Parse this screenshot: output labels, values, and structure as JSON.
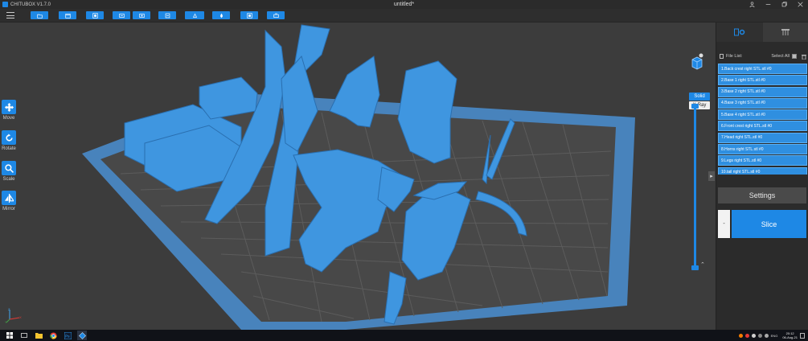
{
  "window": {
    "app_name": "CHITUBOX V1.7.0",
    "doc_title": "untitled*",
    "controls": [
      "user-icon",
      "minimize-icon",
      "maximize-icon",
      "close-icon"
    ]
  },
  "toolbar": {
    "buttons": [
      "open-file-icon",
      "open-folder-icon",
      "auto-layout-icon",
      "hollow-icon",
      "dig-hole-icon",
      "measure-icon",
      "support-icon",
      "resin-icon",
      "preview-icon",
      "print-icon"
    ]
  },
  "left_tools": [
    {
      "label": "Move",
      "icon": "move-icon"
    },
    {
      "label": "Rotate",
      "icon": "rotate-icon"
    },
    {
      "label": "Scale",
      "icon": "scale-icon"
    },
    {
      "label": "Mirror",
      "icon": "mirror-icon"
    }
  ],
  "view_modes": {
    "solid": "Solid",
    "xray": "X-Ray",
    "selected": "Solid"
  },
  "right_panel": {
    "tabs": [
      "file-settings-icon",
      "supports-icon"
    ],
    "file_list_label": "File List:",
    "select_all_label": "Select All",
    "files": [
      "1.Back crest right STL.stl #0",
      "2.Base 1 right STL.stl #0",
      "3.Base 2 right STL.stl #0",
      "4.Base 3 right STL.stl #0",
      "5.Base 4 right STL.stl #0",
      "6.Front crest right STL.stl #0",
      "7.Head right STL.stl #0",
      "8.Horns right STL.stl #0",
      "9.Legs right STL.stl #0",
      "10.tail right STL.stl #0"
    ],
    "settings_label": "Settings",
    "minus_label": "-",
    "slice_label": "Slice"
  },
  "taskbar": {
    "apps": [
      "start-icon",
      "taskview-icon",
      "file-explorer-icon",
      "chrome-icon",
      "photoshop-icon",
      "chitubox-icon"
    ],
    "language": "ENG",
    "time": "20:12",
    "date": "06-Aug-21"
  },
  "colors": {
    "accent": "#1e88e5",
    "model": "#3f96e0",
    "platform": "#4a90d4",
    "bg": "#3c3c3c"
  }
}
